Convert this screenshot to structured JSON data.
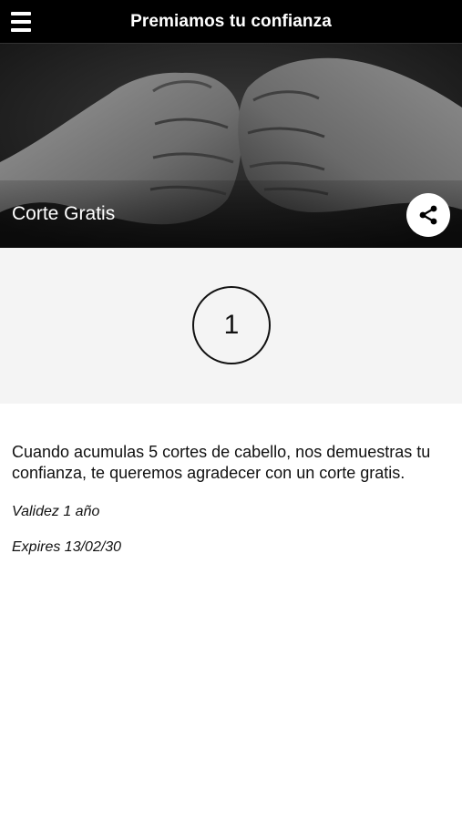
{
  "header": {
    "title": "Premiamos tu confianza",
    "menu_icon": "hamburger-menu-icon"
  },
  "reward": {
    "title": "Corte Gratis",
    "share_icon": "share-icon",
    "counter_value": "1",
    "description": "Cuando acumulas 5 cortes de cabello, nos demuestras tu confianza,  te queremos agradecer con un corte gratis.",
    "validity": "Validez 1 año",
    "expires": "Expires 13/02/30"
  },
  "colors": {
    "header_bg": "#000000",
    "counter_bg": "#f4f4f4",
    "text": "#111111"
  }
}
